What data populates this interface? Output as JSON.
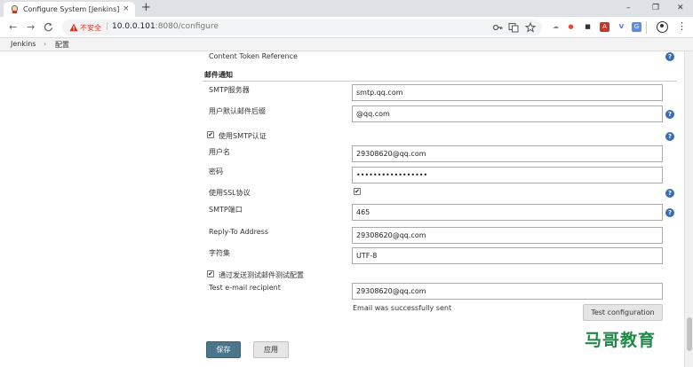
{
  "browser": {
    "tab_title": "Configure System [Jenkins]",
    "tab_close": "×",
    "new_tab": "+",
    "window_controls": {
      "minimize": "–",
      "maximize": "❐",
      "close": "✕"
    },
    "nav": {
      "back": "←",
      "forward": "→",
      "reload": "C"
    },
    "security_label": "不安全",
    "url_host": "10.0.0.101",
    "url_rest": ":8080/configure",
    "extensions": [
      {
        "icon": "cloud-extension-icon",
        "glyph": "☁",
        "color": "#8a8a8a"
      },
      {
        "icon": "red-circle-extension-icon",
        "glyph": "●",
        "color": "#e8453c"
      },
      {
        "icon": "dark-square-extension-icon",
        "glyph": "■",
        "color": "#333333"
      },
      {
        "icon": "red-pdf-extension-icon",
        "glyph": "A",
        "color": "#c0392b"
      },
      {
        "icon": "blue-v-extension-icon",
        "glyph": "V",
        "color": "#4a77d4"
      },
      {
        "icon": "translate-extension-icon",
        "glyph": "G",
        "color": "#5a8de0"
      }
    ],
    "menu_glyph": "⋮"
  },
  "breadcrumb": {
    "items": [
      "Jenkins",
      "配置"
    ],
    "separator": "›"
  },
  "form": {
    "content_token_reference": "Content Token Reference",
    "section_title": "邮件通知",
    "smtp_server": {
      "label": "SMTP服务器",
      "value": "smtp.qq.com"
    },
    "default_suffix": {
      "label": "用户默认邮件后缀",
      "value": "@qq.com"
    },
    "use_smtp_auth": {
      "label": "使用SMTP认证",
      "checked": true
    },
    "username": {
      "label": "用户名",
      "value": "29308620@qq.com"
    },
    "password": {
      "label": "密码",
      "value": "•••••••••••••••••"
    },
    "use_ssl": {
      "label": "使用SSL协议",
      "checked": true
    },
    "smtp_port": {
      "label": "SMTP端口",
      "value": "465"
    },
    "reply_to": {
      "label": "Reply-To Address",
      "value": "29308620@qq.com"
    },
    "charset": {
      "label": "字符集",
      "value": "UTF-8"
    },
    "test_by_sending": {
      "label": "通过发送测试邮件测试配置",
      "checked": true
    },
    "test_recipient": {
      "label": "Test e-mail recipient",
      "value": "29308620@qq.com"
    },
    "status_message": "Email was successfully sent",
    "test_button": "Test configuration",
    "save_button": "保存",
    "apply_button": "应用",
    "help_glyph": "?",
    "check_glyph": "✔"
  },
  "watermark": "马哥教育",
  "colors": {
    "save_button": "#4b758b",
    "help_icon": "#3a6cb4",
    "insecure": "#d93025",
    "watermark": "#1f8a45"
  }
}
